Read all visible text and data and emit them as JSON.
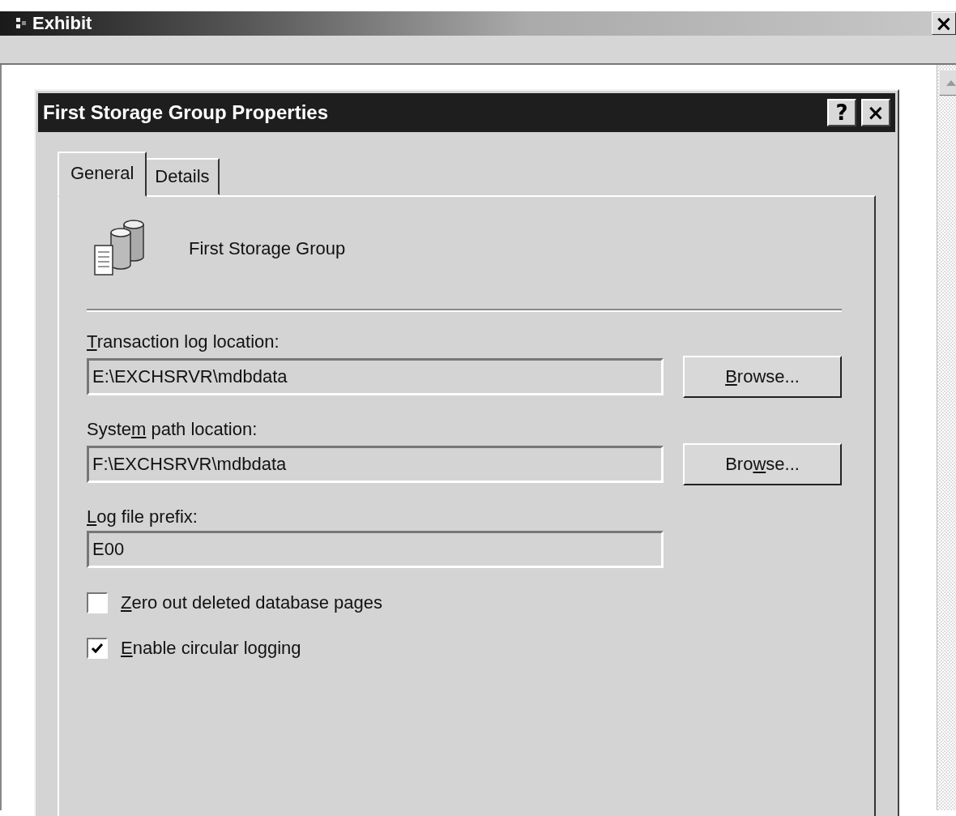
{
  "window": {
    "title": "Exhibit",
    "close": "×"
  },
  "dialog": {
    "title": "First Storage Group Properties",
    "help": "?",
    "close": "×",
    "tabs": [
      {
        "label": "General",
        "selected": true
      },
      {
        "label": "Details",
        "selected": false
      }
    ],
    "header": "First Storage Group",
    "fields": [
      {
        "kind": "path",
        "label": {
          "key": "T",
          "post": "ransaction log location:"
        },
        "value": "E:\\EXCHSRVR\\mdbdata",
        "button": {
          "key": "B",
          "post": "rowse..."
        }
      },
      {
        "kind": "path",
        "label": {
          "pre": "Syste",
          "key": "m",
          "post": " path location:"
        },
        "value": "F:\\EXCHSRVR\\mdbdata",
        "button": {
          "pre": "Bro",
          "key": "w",
          "post": "se..."
        }
      },
      {
        "kind": "text",
        "label": {
          "key": "L",
          "post": "og file prefix:"
        },
        "value": "E00"
      }
    ],
    "checkboxes": [
      {
        "label": {
          "key": "Z",
          "post": "ero out deleted database pages"
        },
        "checked": false
      },
      {
        "label": {
          "key": "E",
          "post": "nable circular logging"
        },
        "checked": true
      }
    ]
  }
}
